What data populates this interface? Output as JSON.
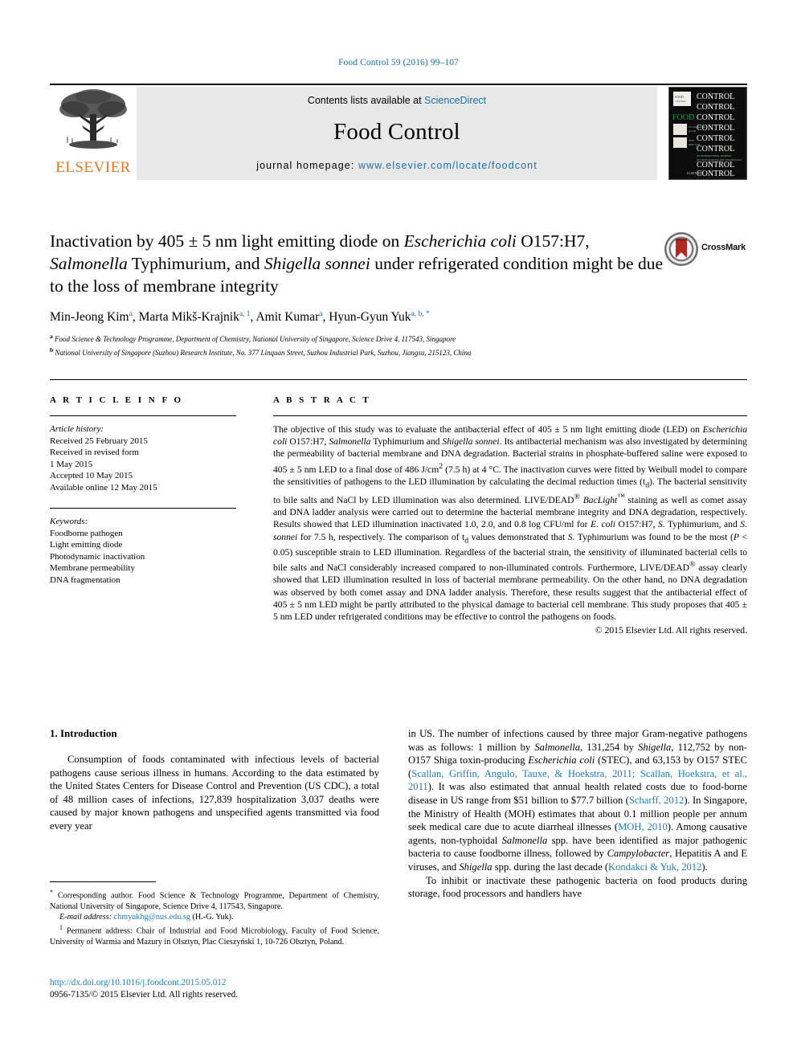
{
  "running_head": "Food Control 59 (2016) 99–107",
  "masthead": {
    "contents_prefix": "Contents lists available at ",
    "sciencedirect": "ScienceDirect",
    "journal_title": "Food Control",
    "homepage_prefix": "journal homepage: ",
    "homepage_url": "www.elsevier.com/locate/foodcont",
    "publisher": "ELSEVIER",
    "cover": {
      "word_food": "FOOD",
      "word_control": "CONTROL",
      "footer_line_1": "AN INTERNATIONAL JOURNAL",
      "footer_line_2": "OF FOOD SCIENCE AND TECHNOLOGY"
    }
  },
  "crossmark": {
    "label": "CrossMark"
  },
  "title": {
    "line1_a": "Inactivation by 405 ",
    "line1_pm": "±",
    "line1_b": " 5 nm light emitting diode on ",
    "line1_italic": "Escherichia coli",
    "line2_a": "O157:H7, ",
    "line2_italic1": "Salmonella",
    "line2_b": " Typhimurium, and ",
    "line2_italic2": "Shigella sonnei",
    "line2_c": " under",
    "line3": "refrigerated condition might be due to the loss of membrane integrity"
  },
  "authors": {
    "a1": "Min-Jeong Kim",
    "a1sup": "a",
    "a2": "Marta Mikš-Krajnik",
    "a2sup": "a, 1",
    "a3": "Amit Kumar",
    "a3sup": "a",
    "a4": "Hyun-Gyun Yuk",
    "a4sup": "a, b, *"
  },
  "affiliations": [
    {
      "mark": "a",
      "text": "Food Science & Technology Programme, Department of Chemistry, National University of Singapore, Science Drive 4, 117543, Singapore"
    },
    {
      "mark": "b",
      "text": "National University of Singapore (Suzhou) Research Institute, No. 377 Linquan Street, Suzhou Industrial Park, Suzhou, Jiangsu, 215123, China"
    }
  ],
  "article_info": {
    "heading": "A R T I C L E   I N F O",
    "history_label": "Article history:",
    "history": [
      "Received 25 February 2015",
      "Received in revised form",
      "1 May 2015",
      "Accepted 10 May 2015",
      "Available online 12 May 2015"
    ],
    "keywords_label": "Keywords:",
    "keywords": [
      "Foodborne pathogen",
      "Light emitting diode",
      "Photodynamic inactivation",
      "Membrane permeability",
      "DNA fragmentation"
    ]
  },
  "abstract": {
    "heading": "A B S T R A C T",
    "p1": "The objective of this study was to evaluate the antibacterial effect of 405 ± 5 nm light emitting diode (LED) on ",
    "it1": "Escherichia coli",
    "p2": " O157:H7, ",
    "it2": "Salmonella",
    "p3": " Typhimurium and ",
    "it3": "Shigella sonnei",
    "p4": ". Its antibacterial mechanism was also investigated by determining the permeability of bacterial membrane and DNA degradation. Bacterial strains in phosphate-buffered saline were exposed to 405 ± 5 nm LED to a final dose of 486 J/cm",
    "sup1": "2",
    "p5": " (7.5 h) at 4 °C. The inactivation curves were fitted by Weibull model to compare the sensitivities of pathogens to the LED illumination by calculating the decimal reduction times (t",
    "sub1": "d",
    "p6": "). The bacterial sensitivity to bile salts and NaCl by LED illumination was also determined. LIVE/DEAD",
    "sup2": "®",
    "it4": " BacLight",
    "sup3": "™",
    "p7": " staining as well as comet assay and DNA ladder analysis were carried out to determine the bacterial membrane integrity and DNA degradation, respectively. Results showed that LED illumination inactivated 1.0, 2.0, and 0.8 log CFU/ml for ",
    "it5": "E. coli",
    "p8": " O157:H7, ",
    "it6": "S.",
    "p9": " Typhimurium, and ",
    "it7": "S. sonnei",
    "p10": " for 7.5 h, respectively. The comparison of t",
    "sub2": "d",
    "p11": " values demonstrated that ",
    "it8": "S.",
    "p12": " Typhimurium was found to be the most (",
    "it9": "P",
    "p13": " < 0.05) susceptible strain to LED illumination. Regardless of the bacterial strain, the sensitivity of illuminated bacterial cells to bile salts and NaCl considerably increased compared to non-illuminated controls. Furthermore, LIVE/DEAD",
    "sup4": "®",
    "p14": " assay clearly showed that LED illumination resulted in loss of bacterial membrane permeability. On the other hand, no DNA degradation was observed by both comet assay and DNA ladder analysis. Therefore, these results suggest that the antibacterial effect of 405 ± 5 nm LED might be partly attributed to the physical damage to bacterial cell membrane. This study proposes that 405 ± 5 nm LED under refrigerated conditions may be effective to control the pathogens on foods.",
    "copyright": "© 2015 Elsevier Ltd. All rights reserved."
  },
  "introduction": {
    "heading": "1. Introduction",
    "left_p1": "Consumption of foods contaminated with infectious levels of bacterial pathogens cause serious illness in humans. According to the data estimated by the United States Centers for Disease Control and Prevention (US CDC), a total of 48 million cases of infections, 127,839 hospitalization 3,037 deaths were caused by major known pathogens and unspecified agents transmitted via food every year",
    "right_p1_a": "in US. The number of infections caused by three major Gram-negative pathogens was as follows: 1 million by ",
    "right_it1": "Salmonella",
    "right_p1_b": ", 131,254 by ",
    "right_it2": "Shigella",
    "right_p1_c": ", 112,752 by non-O157 Shiga toxin-producing ",
    "right_it3": "Escherichia coli",
    "right_p1_d": " (STEC), and 63,153 by O157 STEC (",
    "right_ref1": "Scallan, Griffin, Angulo, Tauxe, & Hoekstra, 2011; Scallan, Hoekstra, et al., 2011",
    "right_p1_e": "). It was also estimated that annual health related costs due to food-borne disease in US range from $51 billion to $77.7 billion (",
    "right_ref2": "Scharff, 2012",
    "right_p1_f": "). In Singapore, the Ministry of Health (MOH) estimates that about 0.1 million people per annum seek medical care due to acute diarrheal illnesses (",
    "right_ref3": "MOH, 2010",
    "right_p1_g": "). Among causative agents, non-typhoidal ",
    "right_it4": "Salmonella",
    "right_p1_h": " spp. have been identified as major pathogenic bacteria to cause foodborne illness, followed by ",
    "right_it5": "Campylobacter",
    "right_p1_i": ", Hepatitis A and E viruses, and ",
    "right_it6": "Shigella",
    "right_p1_j": " spp. during the last decade (",
    "right_ref4": "Kondakci & Yuk, 2012",
    "right_p1_k": ").",
    "right_p2": "To inhibit or inactivate these pathogenic bacteria on food products during storage, food processors and handlers have"
  },
  "footnotes": {
    "corresponding_mark": "*",
    "corresponding": " Corresponding author. Food Science & Technology Programme, Department of Chemistry, National University of Singapore, Science Drive 4, 117543, Singapore.",
    "email_label": "E-mail address:",
    "email": "chmyukhg@nus.edu.sg",
    "email_owner": " (H.-G. Yuk).",
    "permanent_mark": "1",
    "permanent": " Permanent address: Chair of Industrial and Food Microbiology, Faculty of Food Science, University of Warmia and Mazury in Olsztyn, Plac Cieszyński 1, 10-726 Olsztyn, Poland."
  },
  "doi_block": {
    "doi": "http://dx.doi.org/10.1016/j.foodcont.2015.05.012",
    "issn": "0956-7135/© 2015 Elsevier Ltd. All rights reserved."
  },
  "colors": {
    "link": "#1a7fb8",
    "elsevier_orange": "#E87722",
    "masthead_bg": "#e8e8e8",
    "cover_green": "#1f9b4b"
  }
}
